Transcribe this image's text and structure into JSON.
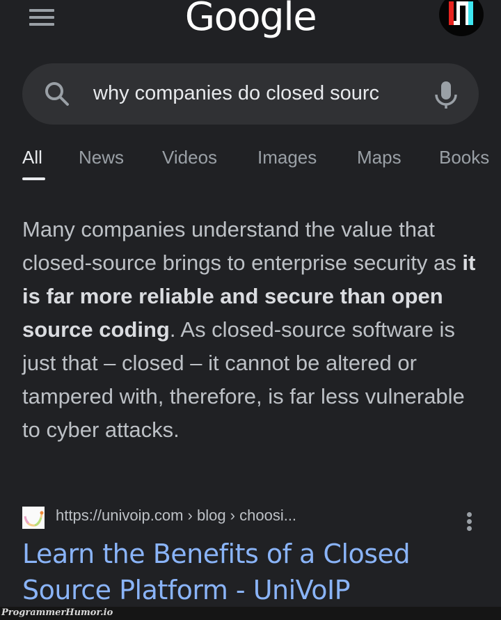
{
  "header": {
    "logo_text": "Google",
    "menu_icon": "hamburger-menu-icon",
    "avatar_icon": "profile-avatar-icon",
    "avatar_colors": {
      "left": "#e8231f",
      "middle": "#ffffff",
      "right": "#3ee6f0"
    }
  },
  "search": {
    "query": "why companies do closed sourc",
    "search_icon": "search-icon",
    "mic_icon": "microphone-icon"
  },
  "tabs": [
    {
      "label": "All",
      "active": true
    },
    {
      "label": "News",
      "active": false
    },
    {
      "label": "Videos",
      "active": false
    },
    {
      "label": "Images",
      "active": false
    },
    {
      "label": "Maps",
      "active": false
    },
    {
      "label": "Books",
      "active": false
    }
  ],
  "featured_snippet": {
    "text_before": "Many companies understand the value that closed-source brings to enterprise security as ",
    "text_bold": "it is far more reliable and secure than open source coding",
    "text_after": ". As closed-source software is just that – closed – it cannot be altered or tampered with, therefore, is far less vulnerable to cyber attacks."
  },
  "result": {
    "favicon": "univoip-favicon",
    "cite": "https://univoip.com › blog › choosi...",
    "more_icon": "more-vert-icon",
    "title": "Learn the Benefits of a Closed Source Platform - UniVoIP"
  },
  "colors": {
    "background": "#202124",
    "search_bg": "#303134",
    "link": "#8ab4f8",
    "text": "#bdc1c6"
  },
  "watermark": "ProgrammerHumor.io"
}
